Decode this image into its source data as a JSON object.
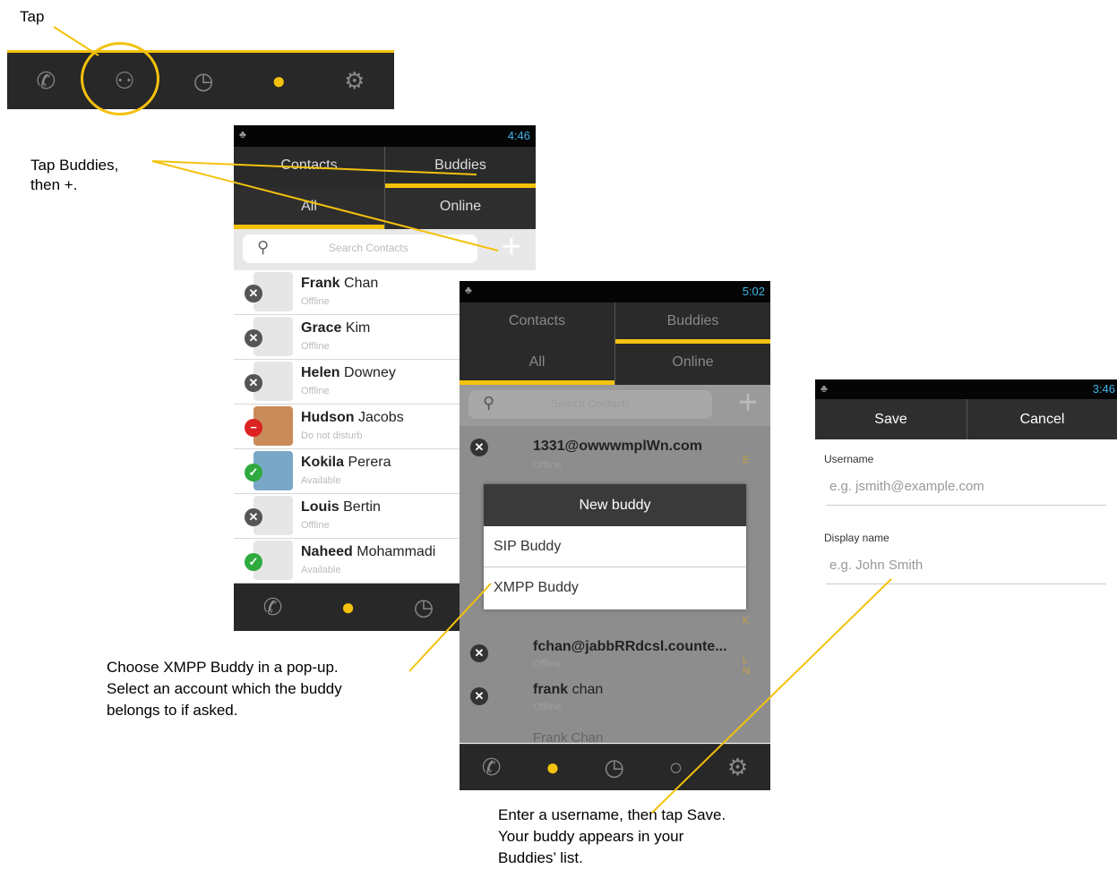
{
  "captions": {
    "tap": "Tap",
    "tap_buddies": [
      "Tap Buddies,",
      "then +."
    ],
    "choose_xmpp": [
      "Choose XMPP Buddy in a pop-up.",
      "Select an account which the buddy",
      "belongs to if asked."
    ],
    "enter_username": [
      "Enter a username, then tap Save.",
      "Your buddy appears in your",
      "Buddies’ list."
    ]
  },
  "colors": {
    "accent": "#f4c20d",
    "dark_bar": "#282828",
    "status_blue": "#3db6e8"
  },
  "top_nav": {
    "icons": [
      "phone-icon",
      "person-icon",
      "clock-icon",
      "chat-icon",
      "gear-icon"
    ],
    "active": 3
  },
  "screen1": {
    "time": "4:46",
    "tabs": [
      "Contacts",
      "Buddies"
    ],
    "subtabs": [
      "All",
      "Online"
    ],
    "search_placeholder": "Search Contacts",
    "contacts": [
      {
        "first": "Frank",
        "last": "Chan",
        "status": "Offline",
        "state": "offline"
      },
      {
        "first": "Grace",
        "last": "Kim",
        "status": "Offline",
        "state": "offline"
      },
      {
        "first": "Helen",
        "last": "Downey",
        "status": "Offline",
        "state": "offline"
      },
      {
        "first": "Hudson",
        "last": "Jacobs",
        "status": "Do not disturb",
        "state": "dnd"
      },
      {
        "first": "Kokila",
        "last": "Perera",
        "status": "Available",
        "state": "available"
      },
      {
        "first": "Louis",
        "last": "Bertin",
        "status": "Offline",
        "state": "offline"
      },
      {
        "first": "Naheed",
        "last": "Mohammadi",
        "status": "Available",
        "state": "available"
      }
    ]
  },
  "screen2": {
    "time": "5:02",
    "tabs": [
      "Contacts",
      "Buddies"
    ],
    "subtabs": [
      "All",
      "Online"
    ],
    "search_placeholder": "Search Contacts",
    "rows": [
      {
        "name": "1331@",
        "rest": "owwwmplWn.com",
        "status": "Offline"
      },
      {
        "name": "fchan@",
        "rest": "jabbRRdcsl.counte...",
        "status": "Offline"
      },
      {
        "name": "frank",
        "rest": " chan",
        "status": "Offline"
      },
      {
        "name": "Frank",
        "rest": " Chan",
        "status": ""
      }
    ],
    "index_letters": [
      "E",
      "K",
      "L",
      "N"
    ],
    "dialog": {
      "title": "New buddy",
      "options": [
        "SIP Buddy",
        "XMPP Buddy"
      ]
    }
  },
  "screen3": {
    "time": "3:46",
    "save": "Save",
    "cancel": "Cancel",
    "username_label": "Username",
    "username_placeholder": "e.g. jsmith@example.com",
    "display_label": "Display name",
    "display_placeholder": "e.g. John Smith"
  }
}
